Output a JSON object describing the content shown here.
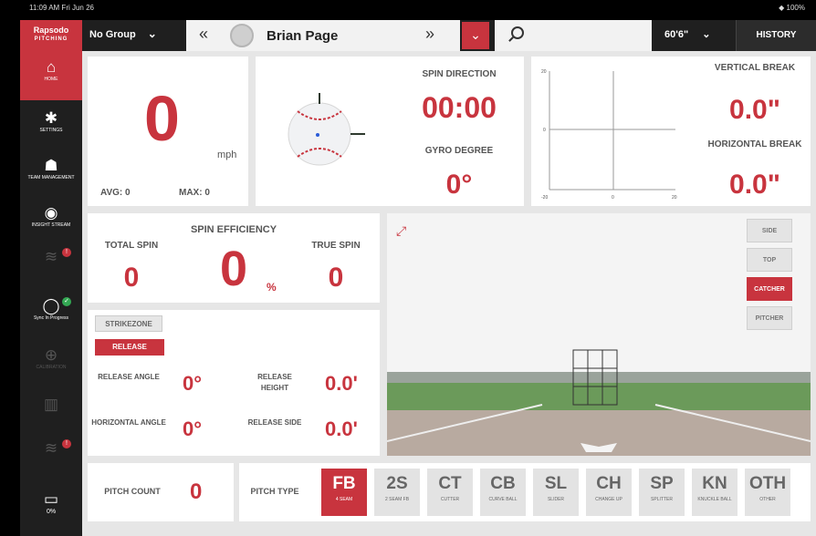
{
  "status_bar": {
    "time": "11:09 AM  Fri Jun 26",
    "battery": "100%"
  },
  "app": {
    "logo_line1": "Rapsodo",
    "logo_line2": "PITCHING"
  },
  "header": {
    "group": "No Group",
    "player_name": "Brian Page",
    "distance": "60'6\"",
    "history_button": "HISTORY"
  },
  "sidebar": {
    "items": [
      {
        "label": "HOME",
        "icon": "home-icon"
      },
      {
        "label": "SETTINGS",
        "icon": "gear-icon"
      },
      {
        "label": "TEAM MANAGEMENT",
        "icon": "team-icon"
      },
      {
        "label": "INSIGHT STREAM",
        "icon": "stream-icon"
      },
      {
        "label": "",
        "icon": "wifi-icon"
      },
      {
        "label": "Sync In Progress",
        "icon": "sync-icon"
      },
      {
        "label": "CALIBRATION",
        "icon": "target-icon"
      },
      {
        "label": "",
        "icon": "device-icon"
      },
      {
        "label": "",
        "icon": "wifi-icon"
      },
      {
        "label": "0%",
        "icon": "battery-icon"
      }
    ]
  },
  "velocity": {
    "value": "0",
    "unit": "mph",
    "avg_label": "AVG:",
    "avg_value": "0",
    "max_label": "MAX:",
    "max_value": "0"
  },
  "spin": {
    "direction_label": "SPIN DIRECTION",
    "direction_value": "00:00",
    "gyro_label": "GYRO DEGREE",
    "gyro_value": "0°"
  },
  "break": {
    "vertical_label": "VERTICAL BREAK",
    "vertical_value": "0.0\"",
    "horizontal_label": "HORIZONTAL BREAK",
    "horizontal_value": "0.0\"",
    "axis_ticks": {
      "top": "20",
      "mid": "0",
      "left": "-20",
      "center": "0",
      "right": "20"
    }
  },
  "efficiency": {
    "total_label": "TOTAL SPIN",
    "total_value": "0",
    "efficiency_label": "SPIN EFFICIENCY",
    "efficiency_value": "0",
    "efficiency_unit": "%",
    "true_label": "TRUE SPIN",
    "true_value": "0"
  },
  "release": {
    "tab_strikezone": "STRIKEZONE",
    "tab_release": "RELEASE",
    "angle_label": "RELEASE ANGLE",
    "angle_value": "0°",
    "height_label": "RELEASE HEIGHT",
    "height_value": "0.0'",
    "hangle_label": "HORIZONTAL ANGLE",
    "hangle_value": "0°",
    "side_label": "RELEASE SIDE",
    "side_value": "0.0'"
  },
  "view_buttons": [
    "SIDE",
    "TOP",
    "CATCHER",
    "PITCHER"
  ],
  "selected_view": "CATCHER",
  "pitch_count": {
    "label": "PITCH COUNT",
    "value": "0"
  },
  "pitch_type": {
    "label": "PITCH TYPE",
    "selected": "FB",
    "types": [
      {
        "abbr": "FB",
        "name": "4 SEAM"
      },
      {
        "abbr": "2S",
        "name": "2 SEAM FB"
      },
      {
        "abbr": "CT",
        "name": "CUTTER"
      },
      {
        "abbr": "CB",
        "name": "CURVE BALL"
      },
      {
        "abbr": "SL",
        "name": "SLIDER"
      },
      {
        "abbr": "CH",
        "name": "CHANGE UP"
      },
      {
        "abbr": "SP",
        "name": "SPLITTER"
      },
      {
        "abbr": "KN",
        "name": "KNUCKLE BALL"
      },
      {
        "abbr": "OTH",
        "name": "OTHER"
      }
    ]
  },
  "colors": {
    "accent": "#c8343e",
    "sidebar": "#1f1f1f",
    "panel": "#ffffff",
    "background": "#e6e6e6"
  }
}
